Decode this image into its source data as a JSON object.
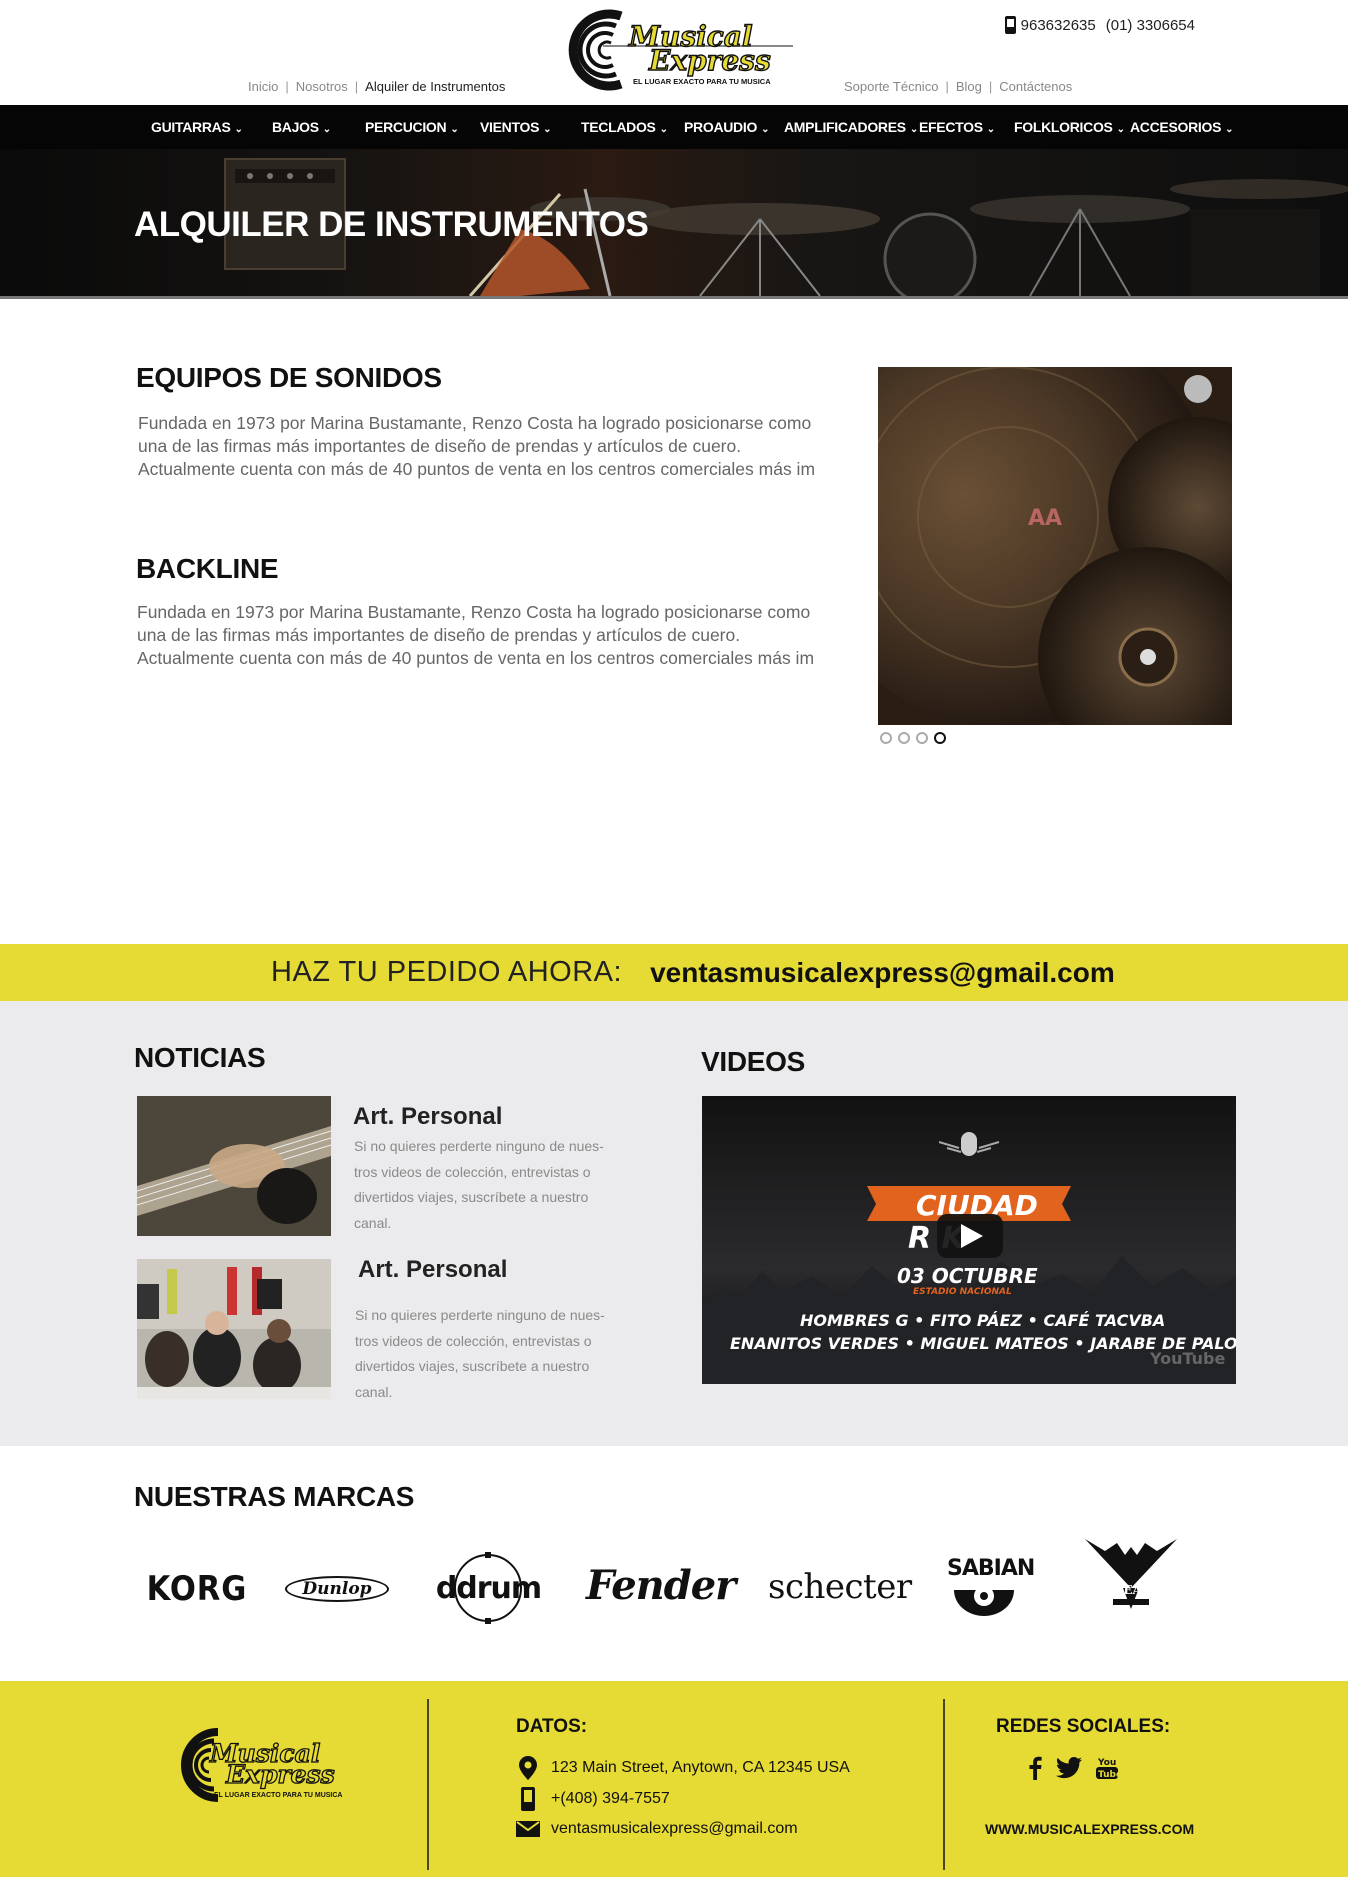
{
  "header": {
    "phone_1": "963632635",
    "phone_2": "(01) 3306654",
    "links_left": [
      "Inicio",
      "Nosotros",
      "Alquiler de Instrumentos"
    ],
    "links_right": [
      "Soporte Técnico",
      "Blog",
      "Contáctenos"
    ],
    "logo_text_1": "Musical",
    "logo_text_2": "Express",
    "logo_tagline": "EL LUGAR EXACTO PARA TU MUSICA"
  },
  "nav": {
    "items": [
      "GUITARRAS",
      "BAJOS",
      "PERCUCION",
      "VIENTOS",
      "TECLADOS",
      "PROAUDIO",
      "AMPLIFICADORES",
      "EFECTOS",
      "FOLKLORICOS",
      "ACCESORIOS"
    ]
  },
  "hero": {
    "title": "ALQUILER DE INSTRUMENTOS"
  },
  "content": {
    "section_1": {
      "title": "EQUIPOS DE SONIDOS",
      "lines": [
        "Fundada en 1973 por Marina Bustamante, Renzo Costa ha logrado posicionarse como",
        "una de las firmas más importantes de diseño de prendas y artículos de cuero.",
        "Actualmente cuenta con más de 40 puntos de venta en los centros comerciales más im"
      ]
    },
    "section_2": {
      "title": "BACKLINE",
      "lines": [
        "Fundada en 1973 por Marina Bustamante, Renzo Costa ha logrado posicionarse como",
        "una de las firmas más importantes de diseño de prendas y artículos de cuero.",
        "Actualmente cuenta con más de 40 puntos de venta en los centros comerciales más im"
      ]
    },
    "slider": {
      "slides": 4,
      "active": 4,
      "cymbal_label": "AA"
    }
  },
  "cta": {
    "label": "HAZ TU PEDIDO AHORA:",
    "email": "ventasmusicalexpress@gmail.com"
  },
  "news": {
    "title": "NOTICIAS",
    "items": [
      {
        "title": "Art. Personal",
        "lines": [
          "Si no quieres perderte ninguno de nues-",
          "tros videos de colección, entrevistas o",
          "divertidos viajes, suscríbete a nuestro",
          "canal."
        ]
      },
      {
        "title": "Art. Personal",
        "lines": [
          "Si no quieres perderte ninguno de nues-",
          "tros videos de colección, entrevistas o",
          "divertidos viajes, suscríbete a nuestro",
          "canal."
        ]
      }
    ]
  },
  "videos": {
    "title": "VIDEOS",
    "event_line_1": "CIUDAD",
    "event_line_2": "R  K",
    "date": "03 OCTUBRE",
    "venue": "ESTADIO NACIONAL",
    "bands_1": "HOMBRES G • FITO PÁEZ • CAFÉ TACVBA",
    "bands_2": "ENANITOS VERDES • MIGUEL MATEOS • JARABE DE PALO",
    "watermark": "YouTube"
  },
  "brands": {
    "title": "NUESTRAS MARCAS",
    "items": [
      "KORG",
      "Dunlop",
      "ddrum",
      "Fender",
      "schecter",
      "SABIAN",
      "DEAN"
    ]
  },
  "footer": {
    "datos_title": "DATOS:",
    "address": "123 Main Street, Anytown, CA 12345 USA",
    "phone": "+(408) 394-7557",
    "email": "ventasmusicalexpress@gmail.com",
    "social_title": "REDES SOCIALES:",
    "url": "WWW.MUSICALEXPRESS.COM"
  },
  "colors": {
    "accent_yellow": "#e6da35",
    "nav_bg": "#050505",
    "gray_band": "#ebebed"
  },
  "icons": [
    "phone-icon",
    "location-icon",
    "mobile-icon",
    "mail-icon",
    "facebook-icon",
    "twitter-icon",
    "youtube-icon",
    "chevron-down-icon",
    "play-icon"
  ]
}
